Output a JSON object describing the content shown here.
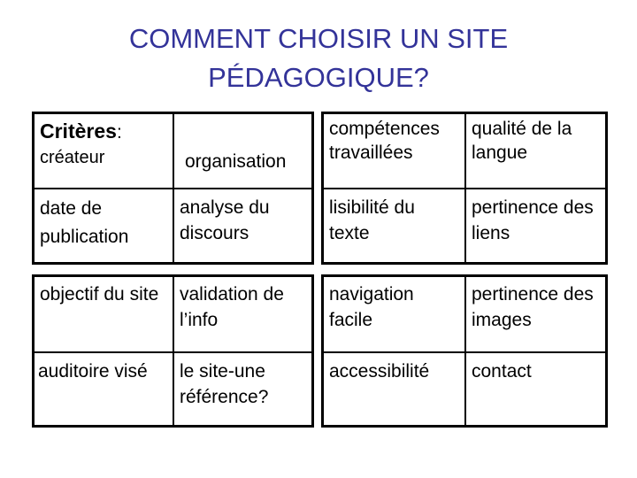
{
  "title": {
    "line1": "COMMENT CHOISIR UN  SITE",
    "line2": "PÉDAGOGIQUE?"
  },
  "criteria_label": "Critères",
  "criteria_colon": ":",
  "cells": {
    "r0c0": "créateur",
    "r0c1": "organisation",
    "r0c2": "compétences travaillées",
    "r0c3": "qualité de la langue",
    "r1c0": "date de publication",
    "r1c1": "analyse du discours",
    "r1c2": "lisibilité du texte",
    "r1c3": "pertinence des liens",
    "r2c0": "objectif du site",
    "r2c1": "validation de l’info",
    "r2c2": "navigation facile",
    "r2c3": "pertinence des images",
    "r3c0": "auditoire visé",
    "r3c1": "le site-une référence?",
    "r3c2": "accessibilité",
    "r3c3": "contact"
  }
}
